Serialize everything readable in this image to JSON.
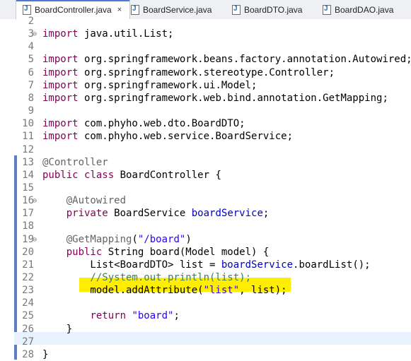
{
  "tabs": [
    {
      "label": "BoardController.java",
      "close": "×"
    },
    {
      "label": "BoardService.java"
    },
    {
      "label": "BoardDTO.java"
    },
    {
      "label": "BoardDAO.java"
    }
  ],
  "lines": [
    {
      "n": "2",
      "fold": "",
      "code": ""
    },
    {
      "n": "3",
      "fold": "⊖",
      "code": "import java.util.List;"
    },
    {
      "n": "4",
      "fold": "",
      "code": ""
    },
    {
      "n": "5",
      "fold": "",
      "code": "import org.springframework.beans.factory.annotation.Autowired;"
    },
    {
      "n": "6",
      "fold": "",
      "code": "import org.springframework.stereotype.Controller;"
    },
    {
      "n": "7",
      "fold": "",
      "code": "import org.springframework.ui.Model;"
    },
    {
      "n": "8",
      "fold": "",
      "code": "import org.springframework.web.bind.annotation.GetMapping;"
    },
    {
      "n": "9",
      "fold": "",
      "code": ""
    },
    {
      "n": "10",
      "fold": "",
      "code": "import com.phyho.web.dto.BoardDTO;"
    },
    {
      "n": "11",
      "fold": "",
      "code": "import com.phyho.web.service.BoardService;"
    },
    {
      "n": "12",
      "fold": "",
      "code": ""
    },
    {
      "n": "13",
      "fold": "",
      "code": "@Controller"
    },
    {
      "n": "14",
      "fold": "",
      "code": "public class BoardController {"
    },
    {
      "n": "15",
      "fold": "",
      "code": ""
    },
    {
      "n": "16",
      "fold": "⊖",
      "code": "    @Autowired"
    },
    {
      "n": "17",
      "fold": "",
      "code": "    private BoardService boardService;"
    },
    {
      "n": "18",
      "fold": "",
      "code": ""
    },
    {
      "n": "19",
      "fold": "⊖",
      "code": "    @GetMapping(\"/board\")"
    },
    {
      "n": "20",
      "fold": "",
      "code": "    public String board(Model model) {"
    },
    {
      "n": "21",
      "fold": "",
      "code": "        List<BoardDTO> list = boardService.boardList();"
    },
    {
      "n": "22",
      "fold": "",
      "code": "        //System.out.println(list);"
    },
    {
      "n": "23",
      "fold": "",
      "code": "        model.addAttribute(\"list\", list);"
    },
    {
      "n": "24",
      "fold": "",
      "code": ""
    },
    {
      "n": "25",
      "fold": "",
      "code": "        return \"board\";"
    },
    {
      "n": "26",
      "fold": "",
      "code": "    }"
    },
    {
      "n": "27",
      "fold": "",
      "code": ""
    },
    {
      "n": "28",
      "fold": "",
      "code": "}"
    }
  ],
  "colors": {
    "keyword": "#7f0055",
    "annotation": "#646464",
    "field": "#0000c0",
    "string": "#2a00ff",
    "comment": "#3f7f5f",
    "highlight": "#ffee00",
    "change_marker": "#5a7fc4"
  },
  "icons": {
    "tab_icon": "java-file-icon",
    "fold_icon": "collapse-icon"
  }
}
